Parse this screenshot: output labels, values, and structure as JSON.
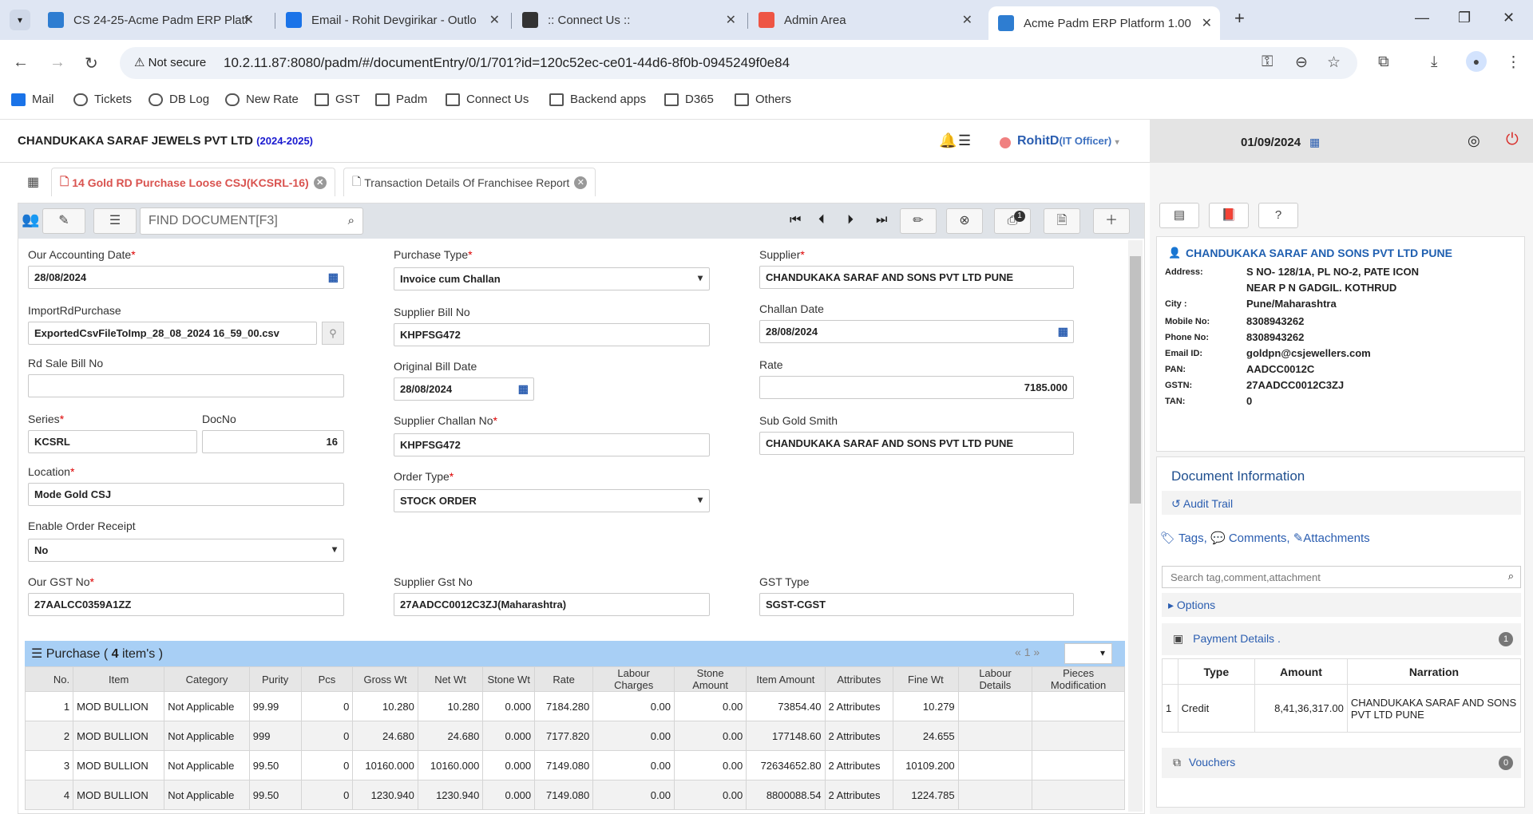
{
  "browser": {
    "tabs": [
      {
        "title": "CS 24-25-Acme Padm ERP Platf",
        "color": "#2e7dd1"
      },
      {
        "title": "Email - Rohit Devgirikar - Outlo",
        "color": "#1a73e8"
      },
      {
        "title": ":: Connect Us ::",
        "color": "#222"
      },
      {
        "title": "Admin Area",
        "color": "#e54"
      },
      {
        "title": "Acme Padm ERP Platform 1.00 :",
        "color": "#2e7dd1"
      }
    ],
    "not_secure": "Not secure",
    "url": "10.2.11.87:8080/padm/#/documentEntry/0/1/701?id=120c52ec-ce01-44d6-8f0b-0945249f0e84",
    "bookmarks": [
      "Mail",
      "Tickets",
      "DB Log",
      "New Rate",
      "GST",
      "Padm",
      "Connect Us",
      "Backend apps",
      "D365",
      "Others"
    ]
  },
  "header": {
    "company": "CHANDUKAKA SARAF JEWELS PVT LTD",
    "fy": "(2024-2025)",
    "user": "RohitD",
    "role": "(IT Officer)",
    "date": "01/09/2024"
  },
  "doc_tabs": [
    "14 Gold RD Purchase Loose CSJ(KCSRL-16)",
    "Transaction Details Of Franchisee Report"
  ],
  "toolbar": {
    "find_placeholder": "FIND DOCUMENT[F3]",
    "print_badge": "1"
  },
  "form": {
    "accounting_date": {
      "label": "Our Accounting Date",
      "value": "28/08/2024"
    },
    "import": {
      "label": "ImportRdPurchase",
      "value": "ExportedCsvFileToImp_28_08_2024 16_59_00.csv"
    },
    "rd_sale_bill": {
      "label": "Rd Sale Bill No",
      "value": ""
    },
    "series": {
      "label": "Series",
      "value": "KCSRL"
    },
    "docno": {
      "label": "DocNo",
      "value": "16"
    },
    "location": {
      "label": "Location",
      "value": "Mode Gold CSJ"
    },
    "enable_order": {
      "label": "Enable Order Receipt",
      "value": "No"
    },
    "our_gst": {
      "label": "Our GST No",
      "value": "27AALCC0359A1ZZ"
    },
    "purchase_type": {
      "label": "Purchase Type",
      "value": "Invoice cum Challan"
    },
    "supplier_bill": {
      "label": "Supplier Bill No",
      "value": "KHPFSG472"
    },
    "orig_bill_date": {
      "label": "Original Bill Date",
      "value": "28/08/2024"
    },
    "supplier_challan": {
      "label": "Supplier Challan No",
      "value": "KHPFSG472"
    },
    "order_type": {
      "label": "Order Type",
      "value": "STOCK ORDER"
    },
    "supplier_gst": {
      "label": "Supplier Gst No",
      "value": "27AADCC0012C3ZJ(Maharashtra)"
    },
    "supplier": {
      "label": "Supplier",
      "value": "CHANDUKAKA SARAF AND SONS PVT LTD PUNE"
    },
    "challan_date": {
      "label": "Challan Date",
      "value": "28/08/2024"
    },
    "rate": {
      "label": "Rate",
      "value": "7185.000"
    },
    "sub_gold_smith": {
      "label": "Sub Gold Smith",
      "value": "CHANDUKAKA SARAF AND SONS PVT LTD PUNE"
    },
    "gst_type": {
      "label": "GST Type",
      "value": "SGST-CGST"
    }
  },
  "grid": {
    "title": "Purchase (",
    "count": "4",
    "items_label": "item's )",
    "page": "1",
    "columns": [
      "No.",
      "Item",
      "Category",
      "Purity",
      "Pcs",
      "Gross Wt",
      "Net Wt",
      "Stone Wt",
      "Rate",
      "Labour Charges",
      "Stone Amount",
      "Item Amount",
      "Attributes",
      "Fine Wt",
      "Labour Details",
      "Pieces Modification"
    ],
    "rows": [
      [
        "1",
        "MOD BULLION",
        "Not Applicable",
        "99.99",
        "0",
        "10.280",
        "10.280",
        "0.000",
        "7184.280",
        "0.00",
        "0.00",
        "73854.40",
        "2 Attributes",
        "10.279",
        "",
        ""
      ],
      [
        "2",
        "MOD BULLION",
        "Not Applicable",
        "999",
        "0",
        "24.680",
        "24.680",
        "0.000",
        "7177.820",
        "0.00",
        "0.00",
        "177148.60",
        "2 Attributes",
        "24.655",
        "",
        ""
      ],
      [
        "3",
        "MOD BULLION",
        "Not Applicable",
        "99.50",
        "0",
        "10160.000",
        "10160.000",
        "0.000",
        "7149.080",
        "0.00",
        "0.00",
        "72634652.80",
        "2 Attributes",
        "10109.200",
        "",
        ""
      ],
      [
        "4",
        "MOD BULLION",
        "Not Applicable",
        "99.50",
        "0",
        "1230.940",
        "1230.940",
        "0.000",
        "7149.080",
        "0.00",
        "0.00",
        "8800088.54",
        "2 Attributes",
        "1224.785",
        "",
        ""
      ]
    ]
  },
  "supplier_card": {
    "name": "CHANDUKAKA SARAF AND SONS PVT LTD PUNE",
    "rows": [
      [
        "Address:",
        "S NO- 128/1A, PL NO-2, PATE ICON"
      ],
      [
        "",
        "NEAR P N GADGIL. KOTHRUD"
      ],
      [
        "City :",
        "Pune/Maharashtra"
      ],
      [
        "Mobile No:",
        "8308943262"
      ],
      [
        "Phone No:",
        "8308943262"
      ],
      [
        "Email ID:",
        "goldpn@csjewellers.com"
      ],
      [
        "PAN:",
        "AADCC0012C"
      ],
      [
        "GSTN:",
        "27AADCC0012C3ZJ"
      ],
      [
        "TAN:",
        "0"
      ]
    ]
  },
  "doc_info": {
    "title": "Document Information",
    "audit": "Audit Trail",
    "tags": "Tags,",
    "comments": "Comments,",
    "attachments": "Attachments",
    "search_placeholder": "Search tag,comment,attachment",
    "options": "Options",
    "payment": "Payment Details .",
    "payment_count": "1",
    "pay_cols": [
      "",
      "Type",
      "Amount",
      "Narration"
    ],
    "pay_row": [
      "1",
      "Credit",
      "8,41,36,317.00",
      "CHANDUKAKA SARAF AND SONS PVT LTD PUNE"
    ],
    "vouchers": "Vouchers",
    "vouchers_count": "0"
  }
}
